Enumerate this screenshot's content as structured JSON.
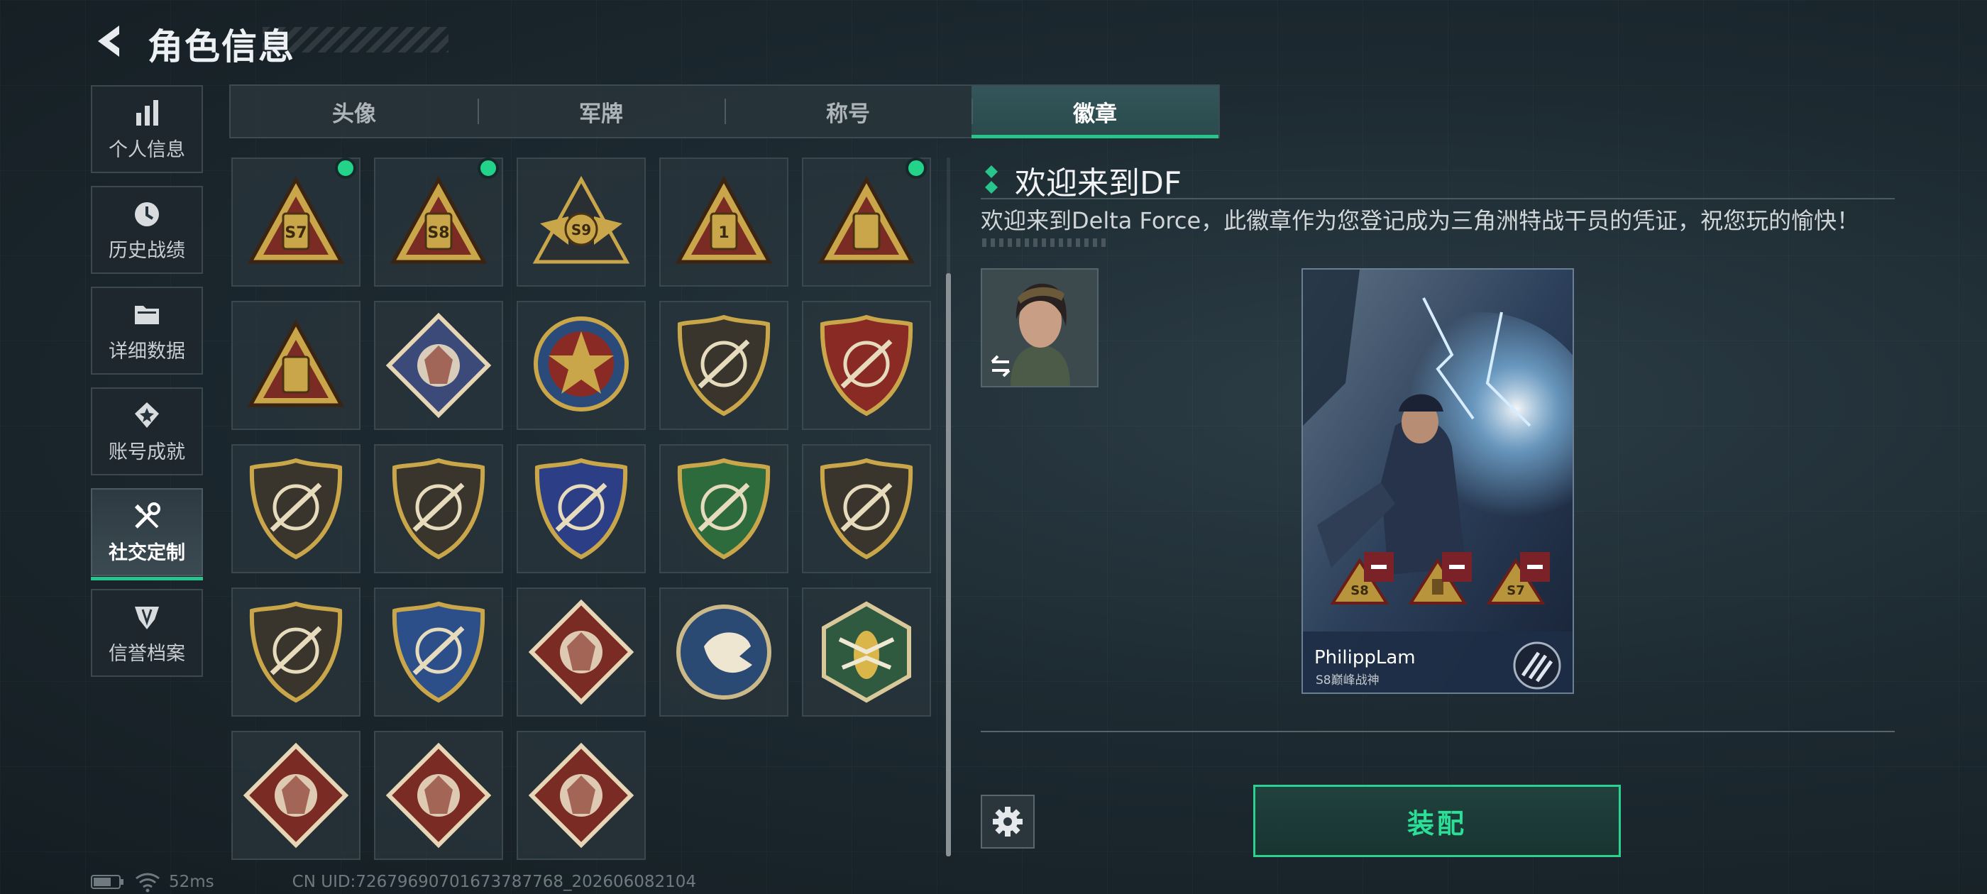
{
  "header": {
    "title": "角色信息"
  },
  "sidebar": {
    "items": [
      {
        "label": "个人信息",
        "icon": "bar-chart-icon"
      },
      {
        "label": "历史战绩",
        "icon": "clock-icon"
      },
      {
        "label": "详细数据",
        "icon": "folder-icon"
      },
      {
        "label": "账号成就",
        "icon": "medal-icon"
      },
      {
        "label": "社交定制",
        "icon": "wrench-screwdriver-icon",
        "active": true
      },
      {
        "label": "信誉档案",
        "icon": "shield-emblem-icon"
      }
    ]
  },
  "tabs": [
    {
      "label": "头像"
    },
    {
      "label": "军牌"
    },
    {
      "label": "称号"
    },
    {
      "label": "徽章",
      "active": true
    }
  ],
  "badges": {
    "selected_index": 0,
    "new_indicator_color": "#23d38a",
    "items": [
      {
        "icon": "badge-s7-triangle-icon",
        "text": "S7",
        "new": true
      },
      {
        "icon": "badge-s8-triangle-icon",
        "text": "S8",
        "new": true
      },
      {
        "icon": "badge-s9-winged-icon",
        "text": "S9",
        "new": false
      },
      {
        "icon": "badge-number-one-triangle-icon",
        "text": "1",
        "new": false
      },
      {
        "icon": "badge-usb-triangle-icon",
        "text": "",
        "new": true
      },
      {
        "icon": "badge-squad-triangle-icon",
        "text": "",
        "new": false
      },
      {
        "icon": "badge-rose-diamond-icon",
        "text": "",
        "new": false
      },
      {
        "icon": "badge-star-emblem-icon",
        "text": "",
        "new": false
      },
      {
        "icon": "badge-chevron-shield-icon",
        "text": "",
        "new": false
      },
      {
        "icon": "badge-laurel-shield-icon",
        "text": "",
        "new": false
      },
      {
        "icon": "badge-gem-shield-icon",
        "text": "",
        "new": false
      },
      {
        "icon": "badge-skull-crosshair-icon",
        "text": "",
        "new": false
      },
      {
        "icon": "badge-blue-rifle-shield-icon",
        "text": "",
        "new": false
      },
      {
        "icon": "badge-green-rifle-shield-icon",
        "text": "",
        "new": false
      },
      {
        "icon": "badge-sniper-shield-icon",
        "text": "",
        "new": false
      },
      {
        "icon": "badge-pistol-shield-icon",
        "text": "",
        "new": false
      },
      {
        "icon": "badge-gold-crosshair-shield-icon",
        "text": "",
        "new": false
      },
      {
        "icon": "badge-wolf-diamond-icon",
        "text": "",
        "new": false
      },
      {
        "icon": "badge-eagle-circle-icon",
        "text": "",
        "new": false
      },
      {
        "icon": "badge-hornet-hexagon-icon",
        "text": "",
        "new": false
      },
      {
        "icon": "badge-dragon-diamond-icon",
        "text": "",
        "new": false
      },
      {
        "icon": "badge-dragon-diamond-icon",
        "text": "",
        "new": false
      },
      {
        "icon": "badge-runner-diamond-icon",
        "text": "",
        "new": false
      }
    ]
  },
  "detail": {
    "name": "欢迎来到DF",
    "description": "欢迎来到Delta Force，此徽章作为您登记成为三角洲特战干员的凭证，祝您玩的愉快！"
  },
  "player_card": {
    "name": "PhilippLam",
    "subtitle": "S8巅峰战神",
    "equipped_badges": [
      "S8",
      "",
      "S7"
    ]
  },
  "actions": {
    "equip_label": "装配"
  },
  "status": {
    "ping": "52ms",
    "uid": "CN UID:7267969070167378776​8_202606082104"
  },
  "colors": {
    "accent": "#27c48c",
    "equip_text": "#2bdf97",
    "badge_gold": "#c9a64a",
    "badge_red": "#7a2b24"
  }
}
